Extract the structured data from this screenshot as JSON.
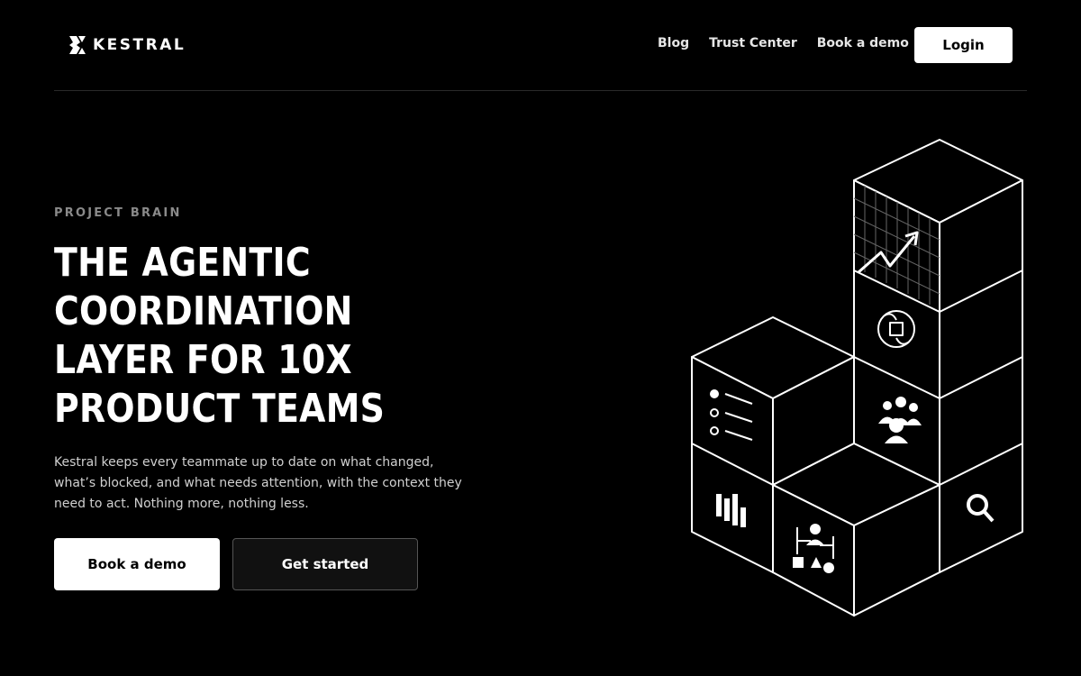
{
  "brand": {
    "name": "KESTRAL"
  },
  "nav": {
    "links": [
      "Blog",
      "Trust Center",
      "Book a demo"
    ],
    "login_label": "Login"
  },
  "hero": {
    "eyebrow": "PROJECT BRAIN",
    "headline_lines": [
      "THE AGENTIC",
      "COORDINATION",
      "LAYER FOR 10X",
      "PRODUCT TEAMS"
    ],
    "description": "Kestral keeps every teammate up to date on what changed, what’s blocked, and what needs attention, with the context they need to act. Nothing more, nothing less.",
    "primary_cta": "Book a demo",
    "secondary_cta": "Get started"
  },
  "illustration": {
    "icons": [
      "growth-chart-icon",
      "brain-chip-icon",
      "team-icon",
      "list-icon",
      "bar-chart-icon",
      "org-chart-icon",
      "search-icon"
    ]
  },
  "colors": {
    "background": "#000000",
    "foreground": "#ffffff",
    "muted": "#8a8a8a",
    "divider": "#2a2a2a"
  }
}
